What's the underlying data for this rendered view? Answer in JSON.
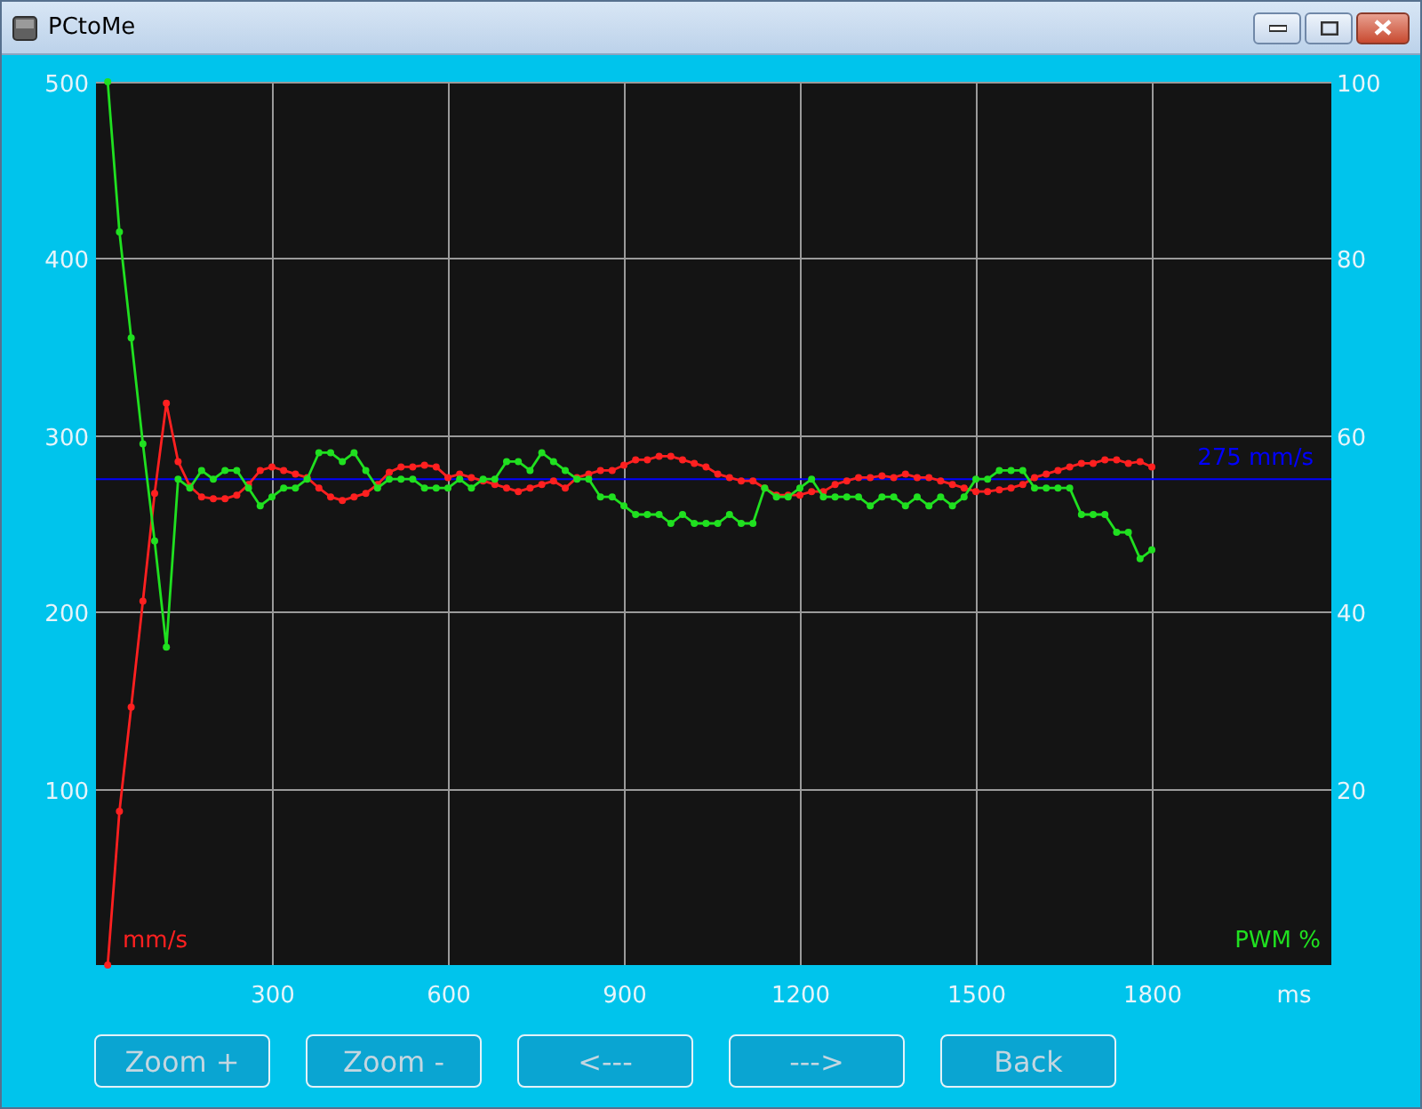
{
  "window": {
    "title": "PCtoMe"
  },
  "chart": {
    "chart_data": {
      "type": "line",
      "xlabel": "ms",
      "x": [
        20,
        40,
        60,
        80,
        100,
        120,
        140,
        160,
        180,
        200,
        220,
        240,
        260,
        280,
        300,
        320,
        340,
        360,
        380,
        400,
        420,
        440,
        460,
        480,
        500,
        520,
        540,
        560,
        580,
        600,
        620,
        640,
        660,
        680,
        700,
        720,
        740,
        760,
        780,
        800,
        820,
        840,
        860,
        880,
        900,
        920,
        940,
        960,
        980,
        1000,
        1020,
        1040,
        1060,
        1080,
        1100,
        1120,
        1140,
        1160,
        1180,
        1200,
        1220,
        1240,
        1260,
        1280,
        1300,
        1320,
        1340,
        1360,
        1380,
        1400,
        1420,
        1440,
        1460,
        1480,
        1500,
        1520,
        1540,
        1560,
        1580,
        1600,
        1620,
        1640,
        1660,
        1680,
        1700,
        1720,
        1740,
        1760,
        1780,
        1800
      ],
      "xlim": [
        0,
        2106
      ],
      "ylim": [
        0,
        500
      ],
      "y2lim": [
        0,
        100
      ],
      "xticks": [
        300,
        600,
        900,
        1200,
        1500,
        1800
      ],
      "yticks": [
        100,
        200,
        300,
        400,
        500
      ],
      "y2ticks": [
        20,
        40,
        60,
        80,
        100
      ],
      "series": [
        {
          "name": "mm/s",
          "color": "#ff2020",
          "marker": "o",
          "values": [
            0,
            87,
            146,
            206,
            267,
            318,
            285,
            271,
            265,
            264,
            264,
            266,
            272,
            280,
            282,
            280,
            278,
            276,
            270,
            265,
            263,
            265,
            267,
            272,
            279,
            282,
            282,
            283,
            282,
            276,
            278,
            276,
            274,
            272,
            270,
            268,
            270,
            272,
            274,
            270,
            276,
            278,
            280,
            280,
            283,
            286,
            286,
            288,
            288,
            286,
            284,
            282,
            278,
            276,
            274,
            274,
            270,
            266,
            266,
            266,
            268,
            268,
            272,
            274,
            276,
            276,
            277,
            276,
            278,
            276,
            276,
            274,
            272,
            270,
            268,
            268,
            269,
            270,
            272,
            276,
            278,
            280,
            282,
            284,
            284,
            286,
            286,
            284,
            285,
            282
          ]
        },
        {
          "name": "PWM %",
          "color": "#20e020",
          "axis": "y2",
          "marker": "o",
          "values": [
            100,
            83,
            71,
            59,
            48,
            36,
            55,
            54,
            56,
            55,
            56,
            56,
            54,
            52,
            53,
            54,
            54,
            55,
            58,
            58,
            57,
            58,
            56,
            54,
            55,
            55,
            55,
            54,
            54,
            54,
            55,
            54,
            55,
            55,
            57,
            57,
            56,
            58,
            57,
            56,
            55,
            55,
            53,
            53,
            52,
            51,
            51,
            51,
            50,
            51,
            50,
            50,
            50,
            51,
            50,
            50,
            54,
            53,
            53,
            54,
            55,
            53,
            53,
            53,
            53,
            52,
            53,
            53,
            52,
            53,
            52,
            53,
            52,
            53,
            55,
            55,
            56,
            56,
            56,
            54,
            54,
            54,
            54,
            51,
            51,
            51,
            49,
            49,
            46,
            47
          ]
        }
      ],
      "grid": true,
      "ref_lines": [
        {
          "axis": "y",
          "value": 275,
          "label": "275 mm/s",
          "color": "#0000ff"
        }
      ]
    }
  },
  "buttons": [
    "Zoom +",
    "Zoom -",
    "<---",
    "--->",
    "Back"
  ]
}
